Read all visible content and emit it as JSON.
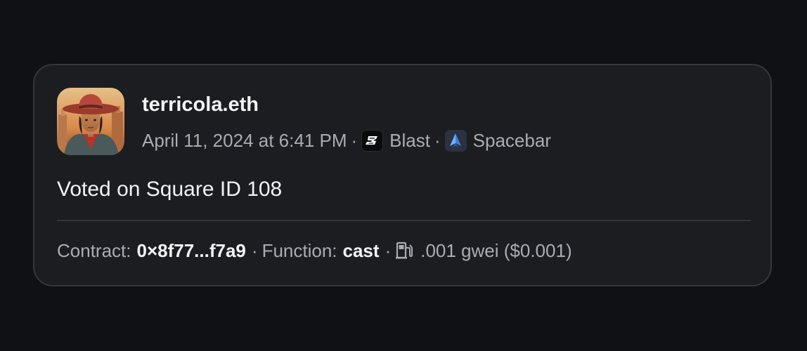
{
  "post": {
    "username": "terricola.eth",
    "timestamp": "April 11, 2024 at 6:41 PM",
    "chain": {
      "label": "Blast",
      "icon": "blast-logo-icon",
      "color": "#0a0a0a"
    },
    "app": {
      "label": "Spacebar",
      "icon": "spacebar-logo-icon",
      "color": "#4f8ef0"
    },
    "separator": "·",
    "avatar": {
      "icon": "user-avatar-image"
    },
    "message": "Voted on Square ID 108"
  },
  "footer": {
    "contract_label": "Contract:",
    "contract_value": "0×8f77...f7a9",
    "function_label": "Function:",
    "function_value": "cast",
    "gas_icon": "gas-pump-icon",
    "gas_value": ".001 gwei ($0.001)",
    "separator": "·"
  },
  "theme": {
    "background": "#0f1114",
    "card": "#1b1d20",
    "border": "#33363b",
    "text_primary": "#f2f3f5",
    "text_secondary": "#a9adb3"
  }
}
